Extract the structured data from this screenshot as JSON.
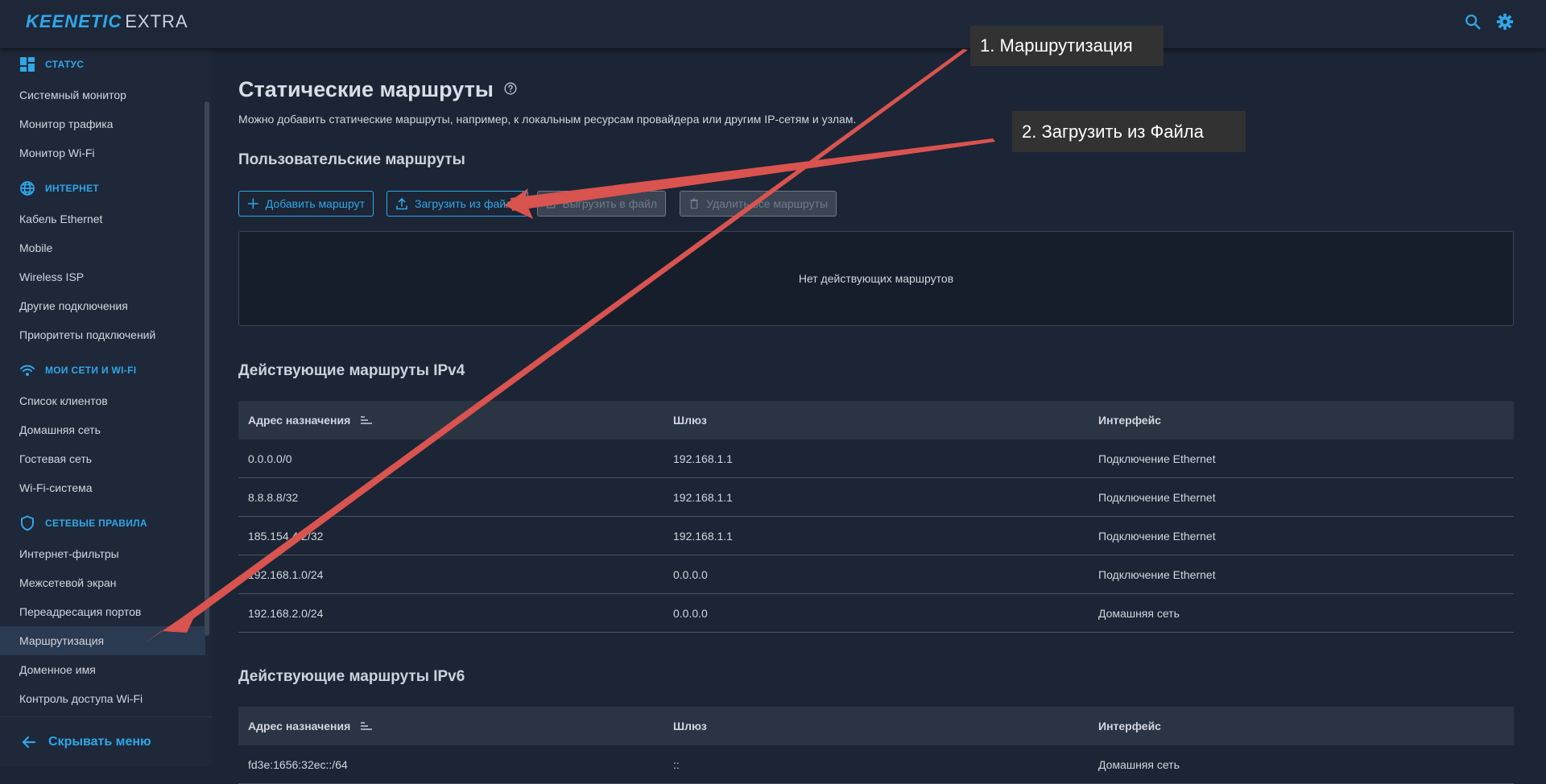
{
  "header": {
    "logo_brand": "KEENETIC",
    "logo_model": "EXTRA",
    "icons": [
      "search-icon",
      "gear-icon"
    ]
  },
  "sidebar": {
    "sections": [
      {
        "label": "СТАТУС",
        "icon": "dashboard-icon",
        "items": [
          "Системный монитор",
          "Монитор трафика",
          "Монитор Wi-Fi"
        ]
      },
      {
        "label": "ИНТЕРНЕТ",
        "icon": "globe-icon",
        "items": [
          "Кабель Ethernet",
          "Mobile",
          "Wireless ISP",
          "Другие подключения",
          "Приоритеты подключений"
        ]
      },
      {
        "label": "МОИ СЕТИ И WI-FI",
        "icon": "wifi-icon",
        "items": [
          "Список клиентов",
          "Домашняя сеть",
          "Гостевая сеть",
          "Wi-Fi-система"
        ]
      },
      {
        "label": "СЕТЕВЫЕ ПРАВИЛА",
        "icon": "shield-icon",
        "items": [
          "Интернет-фильтры",
          "Межсетевой экран",
          "Переадресация портов",
          "Маршрутизация",
          "Доменное имя",
          "Контроль доступа Wi-Fi"
        ]
      }
    ],
    "active_item": "Маршрутизация",
    "hide_menu_label": "Скрывать меню"
  },
  "main": {
    "title": "Статические маршруты",
    "subtitle": "Можно добавить статические маршруты, например, к локальным ресурсам провайдера или другим IP-сетям и узлам.",
    "user_routes": {
      "heading": "Пользовательские маршруты",
      "buttons": {
        "add": "Добавить маршрут",
        "load": "Загрузить из файла",
        "export": "Выгрузить в файл",
        "delete_all": "Удалить все маршруты"
      },
      "empty_text": "Нет действующих маршрутов"
    },
    "ipv4": {
      "heading": "Действующие маршруты IPv4",
      "columns": [
        "Адрес назначения",
        "Шлюз",
        "Интерфейс"
      ],
      "rows": [
        [
          "0.0.0.0/0",
          "192.168.1.1",
          "Подключение Ethernet"
        ],
        [
          "8.8.8.8/32",
          "192.168.1.1",
          "Подключение Ethernet"
        ],
        [
          "185.154.4.2/32",
          "192.168.1.1",
          "Подключение Ethernet"
        ],
        [
          "192.168.1.0/24",
          "0.0.0.0",
          "Подключение Ethernet"
        ],
        [
          "192.168.2.0/24",
          "0.0.0.0",
          "Домашняя сеть"
        ]
      ]
    },
    "ipv6": {
      "heading": "Действующие маршруты IPv6",
      "columns": [
        "Адрес назначения",
        "Шлюз",
        "Интерфейс"
      ],
      "rows": [
        [
          "fd3e:1656:32ec::/64",
          "::",
          "Домашняя сеть"
        ]
      ]
    }
  },
  "annotations": {
    "callout_1": "1. Маршрутизация",
    "callout_2": "2. Загрузить из Файла",
    "arrow_color": "#d9534f"
  },
  "colors": {
    "accent": "#2fa7e8",
    "background": "#1b2535",
    "sidebar": "#1e2839"
  }
}
